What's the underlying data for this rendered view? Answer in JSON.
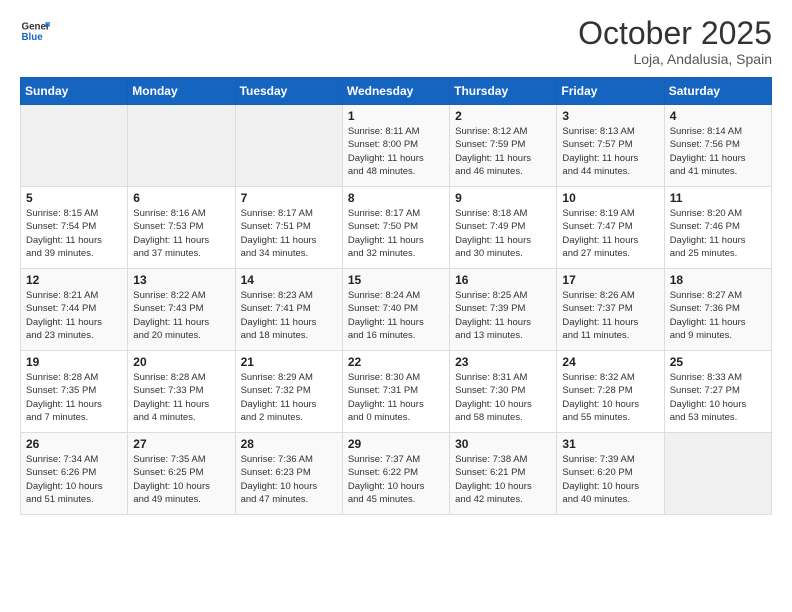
{
  "header": {
    "logo_general": "General",
    "logo_blue": "Blue",
    "title": "October 2025",
    "subtitle": "Loja, Andalusia, Spain"
  },
  "weekdays": [
    "Sunday",
    "Monday",
    "Tuesday",
    "Wednesday",
    "Thursday",
    "Friday",
    "Saturday"
  ],
  "weeks": [
    [
      {
        "day": "",
        "info": ""
      },
      {
        "day": "",
        "info": ""
      },
      {
        "day": "",
        "info": ""
      },
      {
        "day": "1",
        "info": "Sunrise: 8:11 AM\nSunset: 8:00 PM\nDaylight: 11 hours\nand 48 minutes."
      },
      {
        "day": "2",
        "info": "Sunrise: 8:12 AM\nSunset: 7:59 PM\nDaylight: 11 hours\nand 46 minutes."
      },
      {
        "day": "3",
        "info": "Sunrise: 8:13 AM\nSunset: 7:57 PM\nDaylight: 11 hours\nand 44 minutes."
      },
      {
        "day": "4",
        "info": "Sunrise: 8:14 AM\nSunset: 7:56 PM\nDaylight: 11 hours\nand 41 minutes."
      }
    ],
    [
      {
        "day": "5",
        "info": "Sunrise: 8:15 AM\nSunset: 7:54 PM\nDaylight: 11 hours\nand 39 minutes."
      },
      {
        "day": "6",
        "info": "Sunrise: 8:16 AM\nSunset: 7:53 PM\nDaylight: 11 hours\nand 37 minutes."
      },
      {
        "day": "7",
        "info": "Sunrise: 8:17 AM\nSunset: 7:51 PM\nDaylight: 11 hours\nand 34 minutes."
      },
      {
        "day": "8",
        "info": "Sunrise: 8:17 AM\nSunset: 7:50 PM\nDaylight: 11 hours\nand 32 minutes."
      },
      {
        "day": "9",
        "info": "Sunrise: 8:18 AM\nSunset: 7:49 PM\nDaylight: 11 hours\nand 30 minutes."
      },
      {
        "day": "10",
        "info": "Sunrise: 8:19 AM\nSunset: 7:47 PM\nDaylight: 11 hours\nand 27 minutes."
      },
      {
        "day": "11",
        "info": "Sunrise: 8:20 AM\nSunset: 7:46 PM\nDaylight: 11 hours\nand 25 minutes."
      }
    ],
    [
      {
        "day": "12",
        "info": "Sunrise: 8:21 AM\nSunset: 7:44 PM\nDaylight: 11 hours\nand 23 minutes."
      },
      {
        "day": "13",
        "info": "Sunrise: 8:22 AM\nSunset: 7:43 PM\nDaylight: 11 hours\nand 20 minutes."
      },
      {
        "day": "14",
        "info": "Sunrise: 8:23 AM\nSunset: 7:41 PM\nDaylight: 11 hours\nand 18 minutes."
      },
      {
        "day": "15",
        "info": "Sunrise: 8:24 AM\nSunset: 7:40 PM\nDaylight: 11 hours\nand 16 minutes."
      },
      {
        "day": "16",
        "info": "Sunrise: 8:25 AM\nSunset: 7:39 PM\nDaylight: 11 hours\nand 13 minutes."
      },
      {
        "day": "17",
        "info": "Sunrise: 8:26 AM\nSunset: 7:37 PM\nDaylight: 11 hours\nand 11 minutes."
      },
      {
        "day": "18",
        "info": "Sunrise: 8:27 AM\nSunset: 7:36 PM\nDaylight: 11 hours\nand 9 minutes."
      }
    ],
    [
      {
        "day": "19",
        "info": "Sunrise: 8:28 AM\nSunset: 7:35 PM\nDaylight: 11 hours\nand 7 minutes."
      },
      {
        "day": "20",
        "info": "Sunrise: 8:28 AM\nSunset: 7:33 PM\nDaylight: 11 hours\nand 4 minutes."
      },
      {
        "day": "21",
        "info": "Sunrise: 8:29 AM\nSunset: 7:32 PM\nDaylight: 11 hours\nand 2 minutes."
      },
      {
        "day": "22",
        "info": "Sunrise: 8:30 AM\nSunset: 7:31 PM\nDaylight: 11 hours\nand 0 minutes."
      },
      {
        "day": "23",
        "info": "Sunrise: 8:31 AM\nSunset: 7:30 PM\nDaylight: 10 hours\nand 58 minutes."
      },
      {
        "day": "24",
        "info": "Sunrise: 8:32 AM\nSunset: 7:28 PM\nDaylight: 10 hours\nand 55 minutes."
      },
      {
        "day": "25",
        "info": "Sunrise: 8:33 AM\nSunset: 7:27 PM\nDaylight: 10 hours\nand 53 minutes."
      }
    ],
    [
      {
        "day": "26",
        "info": "Sunrise: 7:34 AM\nSunset: 6:26 PM\nDaylight: 10 hours\nand 51 minutes."
      },
      {
        "day": "27",
        "info": "Sunrise: 7:35 AM\nSunset: 6:25 PM\nDaylight: 10 hours\nand 49 minutes."
      },
      {
        "day": "28",
        "info": "Sunrise: 7:36 AM\nSunset: 6:23 PM\nDaylight: 10 hours\nand 47 minutes."
      },
      {
        "day": "29",
        "info": "Sunrise: 7:37 AM\nSunset: 6:22 PM\nDaylight: 10 hours\nand 45 minutes."
      },
      {
        "day": "30",
        "info": "Sunrise: 7:38 AM\nSunset: 6:21 PM\nDaylight: 10 hours\nand 42 minutes."
      },
      {
        "day": "31",
        "info": "Sunrise: 7:39 AM\nSunset: 6:20 PM\nDaylight: 10 hours\nand 40 minutes."
      },
      {
        "day": "",
        "info": ""
      }
    ]
  ]
}
